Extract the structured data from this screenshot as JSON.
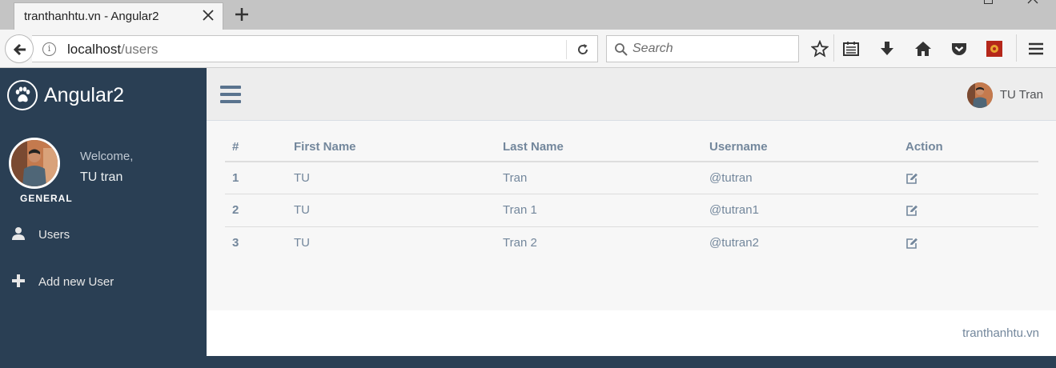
{
  "browser": {
    "tab_title": "tranthanhtu.vn - Angular2",
    "url_host": "localhost",
    "url_path": "/users",
    "search_placeholder": "Search"
  },
  "sidebar": {
    "brand": "Angular2",
    "welcome": "Welcome,",
    "profile_name": "TU tran",
    "section_label": "GENERAL",
    "items": [
      {
        "label": "Users",
        "icon": "user-icon"
      },
      {
        "label": "Add new User",
        "icon": "plus-icon"
      }
    ]
  },
  "topnav": {
    "user_name": "TU Tran"
  },
  "table": {
    "headers": [
      "#",
      "First Name",
      "Last Name",
      "Username",
      "Action"
    ],
    "rows": [
      {
        "index": "1",
        "first": "TU",
        "last": "Tran",
        "username": "@tutran"
      },
      {
        "index": "2",
        "first": "TU",
        "last": "Tran 1",
        "username": "@tutran1"
      },
      {
        "index": "3",
        "first": "TU",
        "last": "Tran 2",
        "username": "@tutran2"
      }
    ]
  },
  "footer": {
    "text": "tranthanhtu.vn"
  },
  "colors": {
    "sidebar_bg": "#2a3f54",
    "text_muted": "#73879c",
    "accent": "#5a738e"
  }
}
